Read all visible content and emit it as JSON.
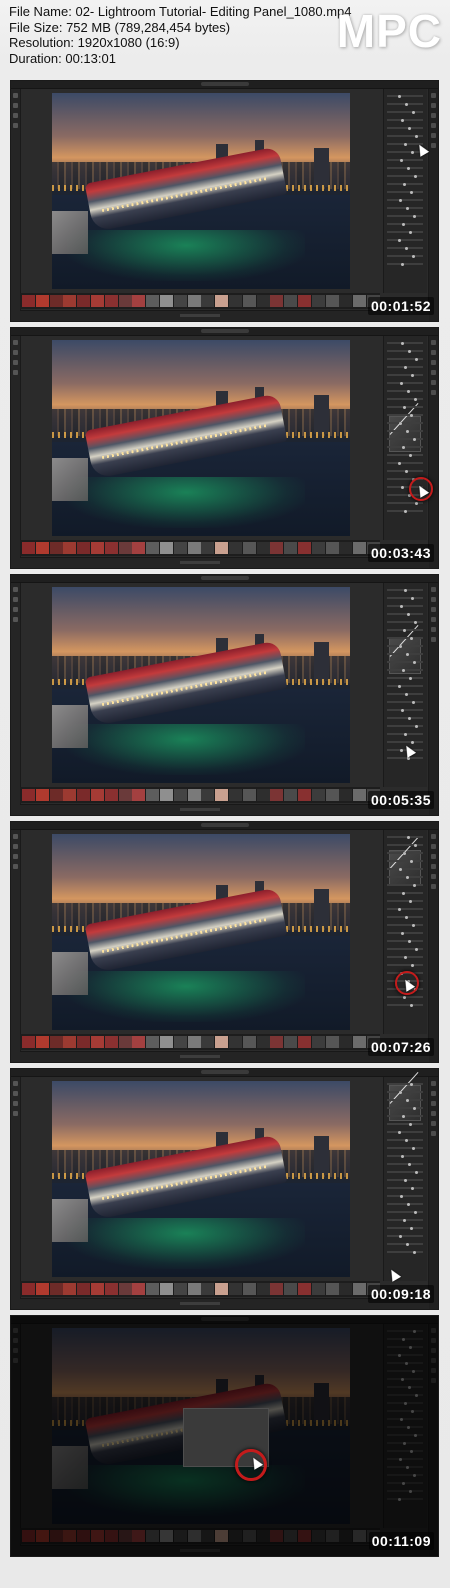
{
  "info": {
    "file_name": "File Name: 02- Lightroom Tutorial- Editing Panel_1080.mp4",
    "file_size": "File Size: 752 MB (789,284,454 bytes)",
    "resolution": "Resolution: 1920x1080 (16:9)",
    "duration": "Duration: 00:13:01"
  },
  "logo": "MPC",
  "frames": [
    {
      "timestamp": "00:01:52"
    },
    {
      "timestamp": "00:03:43"
    },
    {
      "timestamp": "00:05:35"
    },
    {
      "timestamp": "00:07:26"
    },
    {
      "timestamp": "00:09:18"
    },
    {
      "timestamp": "00:11:09"
    }
  ],
  "colors": {
    "app_background": "#2b2b2b",
    "cursor_highlight": "#c41b1b",
    "timestamp_text": "#ffffff"
  }
}
